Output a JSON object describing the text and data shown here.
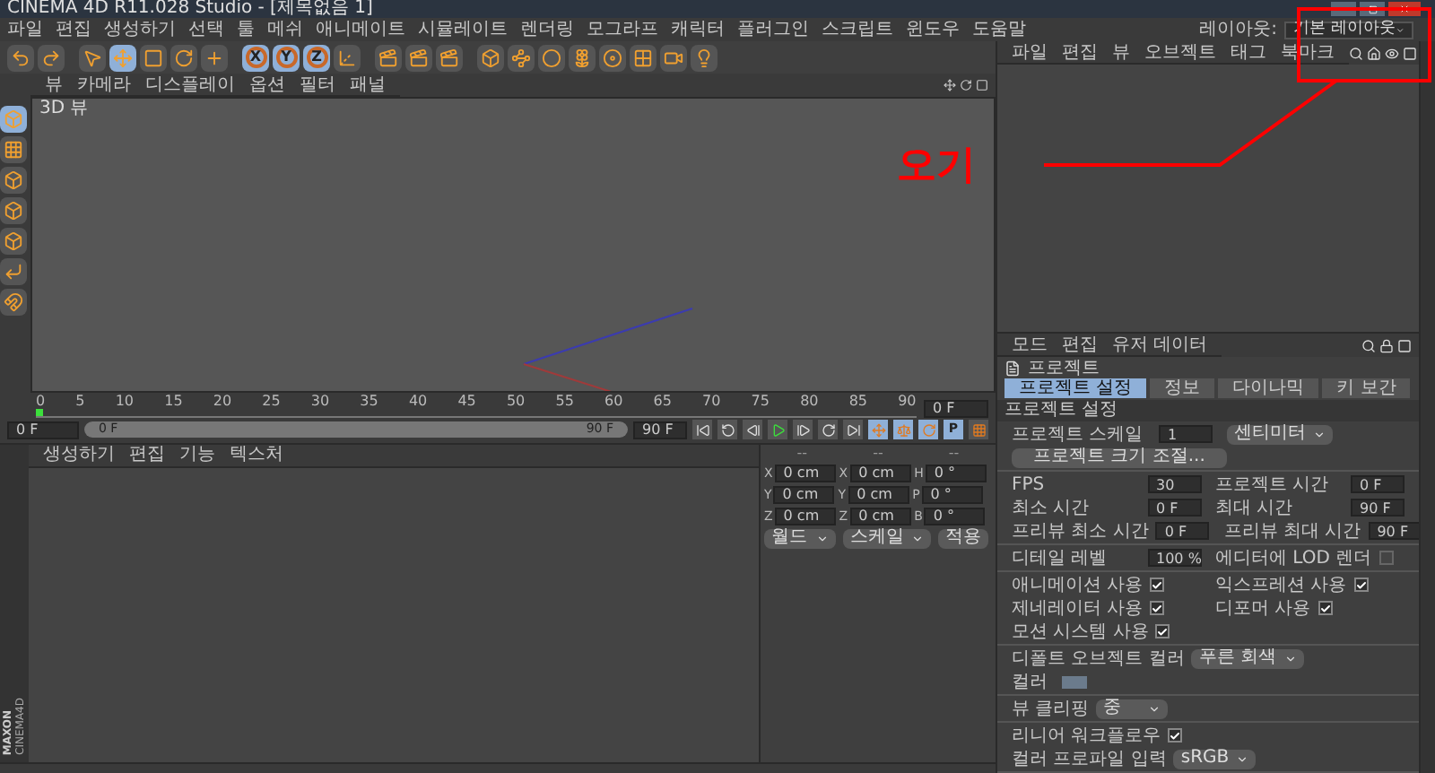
{
  "window": {
    "title": "CINEMA 4D R11.028 Studio - [제목없음 1]"
  },
  "menu": [
    "파일",
    "편집",
    "생성하기",
    "선택",
    "툴",
    "메쉬",
    "애니메이트",
    "시뮬레이트",
    "렌더링",
    "모그라프",
    "캐릭터",
    "플러그인",
    "스크립트",
    "윈도우",
    "도움말"
  ],
  "layout": {
    "label": "레이아웃:",
    "value": "기본 레이아웃"
  },
  "toolbar": [
    {
      "selected": false
    },
    {
      "selected": false
    },
    {
      "selected": false
    },
    {
      "selected": true
    },
    {
      "selected": false
    },
    {
      "selected": false
    },
    {
      "selected": false
    },
    {
      "label": "X",
      "selected": true
    },
    {
      "label": "Y",
      "selected": true
    },
    {
      "label": "Z",
      "selected": true
    },
    {
      "selected": false
    },
    {
      "selected": false
    },
    {
      "selected": false
    },
    {
      "selected": false
    },
    {
      "selected": false
    },
    {
      "selected": false
    },
    {
      "selected": false
    },
    {
      "selected": false
    },
    {
      "selected": false
    },
    {
      "selected": false
    },
    {
      "selected": false
    },
    {
      "selected": false
    }
  ],
  "mode_bar": [
    {
      "selected": true
    },
    {
      "selected": false
    },
    {
      "selected": false
    },
    {
      "selected": false
    },
    {
      "selected": false
    },
    {
      "selected": false
    },
    {
      "selected": false
    }
  ],
  "viewport": {
    "menu": [
      "뷰",
      "카메라",
      "디스플레이",
      "옵션",
      "필터",
      "패널"
    ],
    "label": "3D 뷰"
  },
  "object_manager": {
    "menu": [
      "파일",
      "편집",
      "뷰",
      "오브젝트",
      "태그",
      "북마크"
    ]
  },
  "attributes": {
    "menu": [
      "모드",
      "편집",
      "유저 데이터"
    ],
    "object": "프로젝트",
    "tabs": [
      {
        "label": "프로젝트 설정",
        "selected": true
      },
      {
        "label": "정보",
        "selected": false
      },
      {
        "label": "다이나믹",
        "selected": false
      },
      {
        "label": "키 보간",
        "selected": false
      }
    ],
    "section": "프로젝트 설정",
    "groups": [
      [
        [
          {
            "kind": "number",
            "label": "프로젝트 스케일",
            "value": "1"
          },
          {
            "kind": "dropdown",
            "value": "센티미터"
          }
        ],
        [
          {
            "kind": "button",
            "label": "프로젝트 크기 조절..."
          }
        ]
      ],
      [
        [
          {
            "kind": "number",
            "label": "FPS",
            "value": "30"
          },
          {
            "kind": "number",
            "label": "프로젝트 시간",
            "value": "0 F"
          }
        ],
        [
          {
            "kind": "number",
            "label": "최소 시간",
            "value": "0 F"
          },
          {
            "kind": "number",
            "label": "최대 시간",
            "value": "90 F"
          }
        ],
        [
          {
            "kind": "number",
            "label": "프리뷰 최소 시간",
            "value": "0 F"
          },
          {
            "kind": "number",
            "label": "프리뷰 최대 시간",
            "value": "90 F"
          }
        ]
      ],
      [
        [
          {
            "kind": "number",
            "label": "디테일 레벨",
            "value": "100 %"
          },
          {
            "kind": "check",
            "label": "에디터에 LOD 렌더",
            "checked": false
          }
        ]
      ],
      [
        [
          {
            "kind": "check",
            "label": "애니메이션 사용",
            "checked": true
          },
          {
            "kind": "check",
            "label": "익스프레션 사용",
            "checked": true
          }
        ],
        [
          {
            "kind": "check",
            "label": "제네레이터 사용",
            "checked": true
          },
          {
            "kind": "check",
            "label": "디포머 사용",
            "checked": true
          }
        ],
        [
          {
            "kind": "check",
            "label": "모션 시스템 사용",
            "checked": true
          }
        ]
      ],
      [
        [
          {
            "kind": "dropdown",
            "label": "디폴트 오브젝트 컬러",
            "value": "푸른 회색"
          }
        ],
        [
          {
            "kind": "color",
            "label": "컬러"
          }
        ]
      ],
      [
        [
          {
            "kind": "dropdown",
            "label": "뷰 클리핑",
            "value": "중"
          }
        ]
      ],
      [
        [
          {
            "kind": "check",
            "label": "리니어 워크플로우",
            "checked": true
          }
        ],
        [
          {
            "kind": "dropdown",
            "label": "컬러 프로파일 입력",
            "value": "sRGB"
          }
        ]
      ]
    ]
  },
  "timeline": {
    "ticks": [
      "0",
      "5",
      "10",
      "15",
      "20",
      "25",
      "30",
      "35",
      "40",
      "45",
      "50",
      "55",
      "60",
      "65",
      "70",
      "75",
      "80",
      "85",
      "90"
    ],
    "level": 0,
    "end_field": "0 F",
    "current": "0 F",
    "range": {
      "start": "0 F",
      "end": "90 F",
      "level": 1
    },
    "max": "90 F"
  },
  "key_tools": [
    {
      "selected": true
    },
    {
      "selected": true
    },
    {
      "selected": true
    },
    {
      "label": "P",
      "selected": true
    },
    {
      "selected": false
    }
  ],
  "material_manager": {
    "menu": [
      "생성하기",
      "편집",
      "기능",
      "텍스처"
    ]
  },
  "coordinates": {
    "headers": [
      "--",
      "--",
      "--"
    ],
    "rows": [
      [
        {
          "axis": "X",
          "value": "0 cm"
        },
        {
          "axis": "X",
          "value": "0 cm"
        },
        {
          "axis": "H",
          "value": "0 °"
        }
      ],
      [
        {
          "axis": "Y",
          "value": "0 cm"
        },
        {
          "axis": "Y",
          "value": "0 cm"
        },
        {
          "axis": "P",
          "value": "0 °"
        }
      ],
      [
        {
          "axis": "Z",
          "value": "0 cm"
        },
        {
          "axis": "Z",
          "value": "0 cm"
        },
        {
          "axis": "B",
          "value": "0 °"
        }
      ]
    ],
    "dropdowns": [
      "월드",
      "스케일"
    ],
    "apply": "적용"
  },
  "brand": {
    "company": "MAXON",
    "product": "CINEMA4D"
  },
  "annotation": {
    "text": "오기"
  }
}
